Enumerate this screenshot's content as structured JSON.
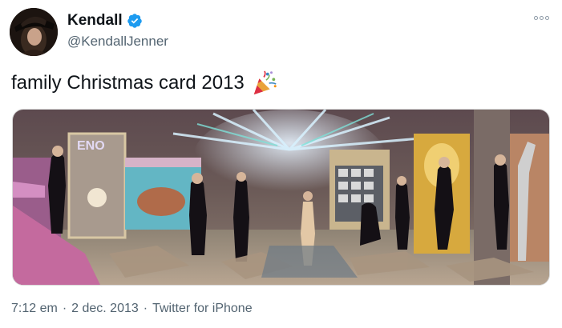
{
  "user": {
    "display_name": "Kendall",
    "handle": "@KendallJenner",
    "verified_icon": "verified-badge-icon",
    "avatar_icon": "profile-photo"
  },
  "tweet": {
    "text": "family Christmas card 2013",
    "emoji_icon": "party-popper-icon",
    "media_alt": "family Christmas card photo"
  },
  "meta": {
    "time": "7:12 em",
    "separator": "·",
    "date": "2 dec. 2013",
    "separator2": "·",
    "source": "Twitter for iPhone"
  },
  "menu": {
    "icon": "more-options-icon"
  },
  "colors": {
    "verified": "#1d9bf0",
    "muted": "#536471",
    "text": "#0f1419"
  }
}
